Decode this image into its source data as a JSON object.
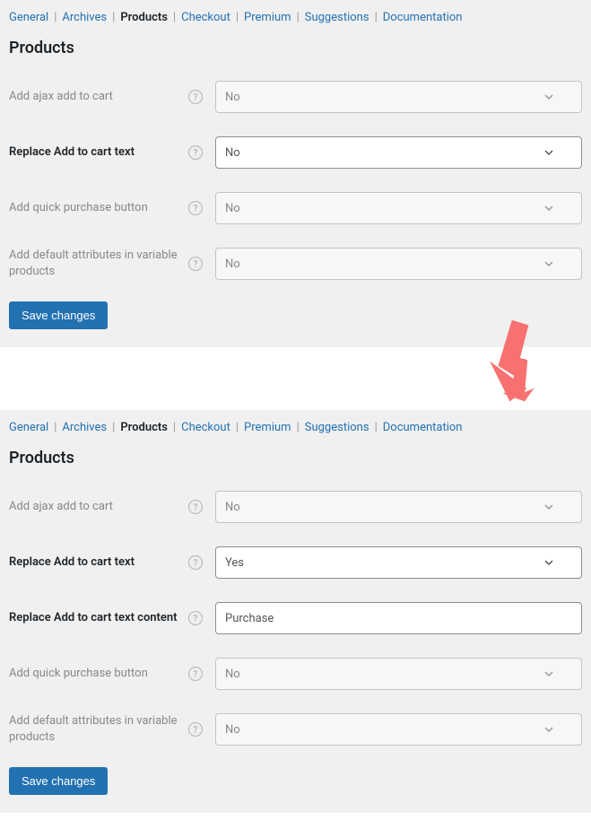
{
  "nav": {
    "items": [
      {
        "label": "General",
        "active": false
      },
      {
        "label": "Archives",
        "active": false
      },
      {
        "label": "Products",
        "active": true
      },
      {
        "label": "Checkout",
        "active": false
      },
      {
        "label": "Premium",
        "active": false
      },
      {
        "label": "Suggestions",
        "active": false
      },
      {
        "label": "Documentation",
        "active": false
      }
    ]
  },
  "top": {
    "heading": "Products",
    "rows": {
      "ajax_cart": {
        "label": "Add ajax add to cart",
        "value": "No",
        "bold": false,
        "disabled": true
      },
      "replace_cart": {
        "label": "Replace Add to cart text",
        "value": "No",
        "bold": true,
        "disabled": false
      },
      "quick_purchase": {
        "label": "Add quick purchase button",
        "value": "No",
        "bold": false,
        "disabled": true
      },
      "default_attrs": {
        "label": "Add default attributes in variable products",
        "value": "No",
        "bold": false,
        "disabled": true
      }
    },
    "save": "Save changes"
  },
  "bottom": {
    "heading": "Products",
    "rows": {
      "ajax_cart": {
        "label": "Add ajax add to cart",
        "value": "No",
        "bold": false,
        "disabled": true
      },
      "replace_cart": {
        "label": "Replace Add to cart text",
        "value": "Yes",
        "bold": true,
        "disabled": false
      },
      "replace_cart_content": {
        "label": "Replace Add to cart text content",
        "value": "Purchase",
        "bold": true,
        "disabled": false,
        "type": "text"
      },
      "quick_purchase": {
        "label": "Add quick purchase button",
        "value": "No",
        "bold": false,
        "disabled": true
      },
      "default_attrs": {
        "label": "Add default attributes in variable products",
        "value": "No",
        "bold": false,
        "disabled": true
      }
    },
    "save": "Save changes"
  }
}
